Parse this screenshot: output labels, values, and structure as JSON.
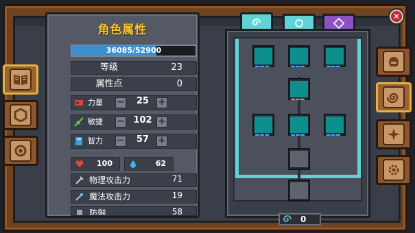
{
  "attributes_panel": {
    "title": "角色属性",
    "exp": {
      "text": "36085/52900",
      "fraction": 0.682
    },
    "rows": [
      {
        "label": "等级",
        "value": "23"
      },
      {
        "label": "属性点",
        "value": "0"
      }
    ],
    "stats": [
      {
        "label": "力量",
        "value": "25",
        "icon": "strength-icon"
      },
      {
        "label": "敏捷",
        "value": "102",
        "icon": "agility-icon"
      },
      {
        "label": "智力",
        "value": "57",
        "icon": "intellect-icon"
      }
    ],
    "hp": "100",
    "mp": "62",
    "combat": [
      {
        "label": "物理攻击力",
        "value": "71",
        "icon": "sword-icon"
      },
      {
        "label": "魔法攻击力",
        "value": "19",
        "icon": "wand-icon"
      },
      {
        "label": "防御",
        "value": "58",
        "icon": "shield-icon"
      }
    ],
    "minus": "−",
    "plus": "+"
  },
  "skill_tree": {
    "points": "0",
    "tabs": [
      "skill-tab-1",
      "skill-tab-2",
      "skill-tab-3"
    ]
  },
  "close_label": "✕",
  "colors": {
    "title": "#f4c436",
    "exp_fill": "#3a8fd0",
    "tree_frame": "#5fd3d6",
    "skill_face": "#0f8e8e"
  }
}
